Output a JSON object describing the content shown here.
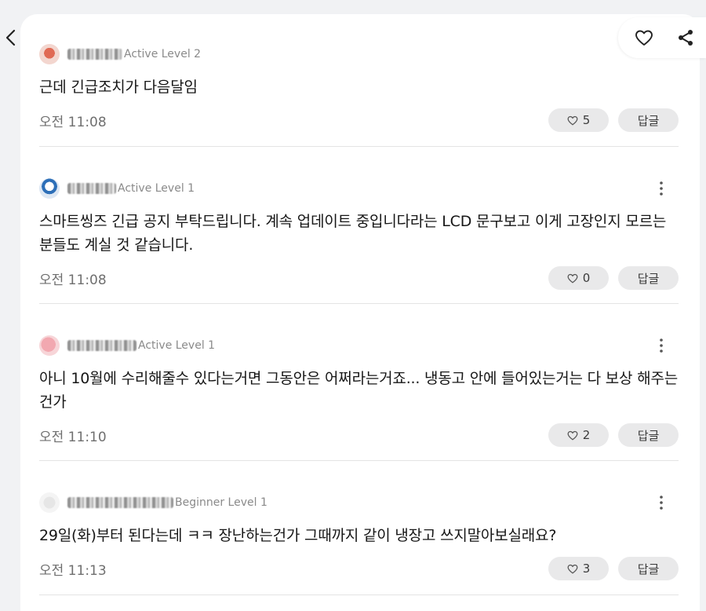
{
  "header": {
    "back_icon": "chevron-left-icon",
    "like_icon": "heart-icon",
    "share_icon": "share-icon"
  },
  "comments": [
    {
      "avatar_color": "#e06a55",
      "level": "Active Level 2",
      "text": "근데 긴급조치가 다음달임",
      "time": "오전 11:08",
      "likes": "5",
      "reply_label": "답글"
    },
    {
      "avatar_color": "#2d6fb8",
      "level": "Active Level 1",
      "text": "스마트씽즈 긴급 공지 부탁드립니다. 계속 업데이트 중입니다라는 LCD 문구보고 이게 고장인지 모르는 분들도 계실 것 같습니다.",
      "time": "오전 11:08",
      "likes": "0",
      "reply_label": "답글"
    },
    {
      "avatar_color": "#f2a8b0",
      "level": "Active Level 1",
      "text": "아니 10월에 수리해줄수 있다는거면 그동안은 어쩌라는거죠... 냉동고 안에 들어있는거는 다 보상 해주는건가",
      "time": "오전 11:10",
      "likes": "2",
      "reply_label": "답글"
    },
    {
      "avatar_color": "#e6e6e6",
      "level": "Beginner Level 1",
      "text": "29일(화)부터 된다는데 ㅋㅋ 장난하는건가 그때까지 같이 냉장고 쓰지말아보실래요?",
      "time": "오전 11:13",
      "likes": "3",
      "reply_label": "답글"
    }
  ]
}
